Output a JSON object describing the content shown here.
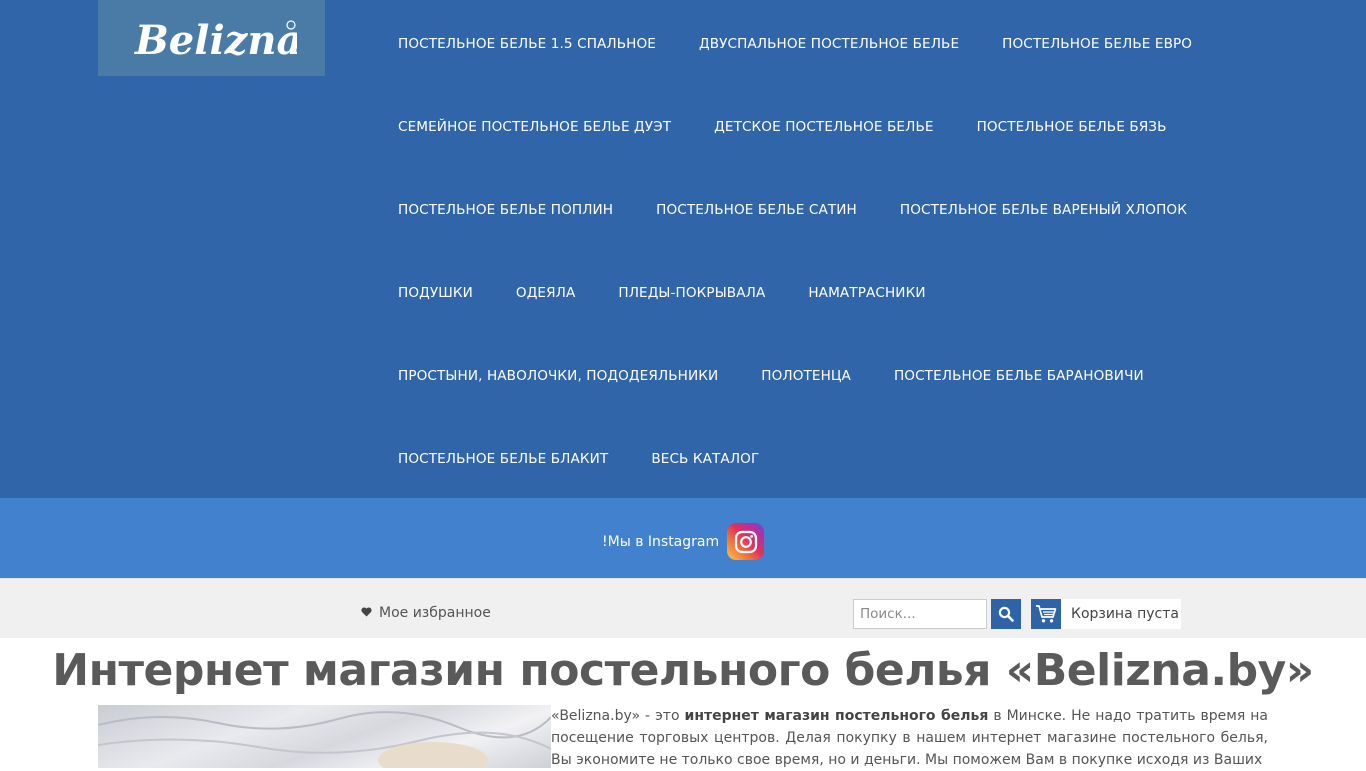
{
  "header": {
    "logo_text": "Belizna",
    "nav_rows": [
      [
        "ПОСТЕЛЬНОЕ БЕЛЬЕ 1.5 СПАЛЬНОЕ",
        "ДВУСПАЛЬНОЕ ПОСТЕЛЬНОЕ БЕЛЬЕ",
        "ПОСТЕЛЬНОЕ БЕЛЬЕ ЕВРО"
      ],
      [
        "СЕМЕЙНОЕ ПОСТЕЛЬНОЕ БЕЛЬЕ ДУЭТ",
        "ДЕТСКОЕ ПОСТЕЛЬНОЕ БЕЛЬЕ",
        "ПОСТЕЛЬНОЕ БЕЛЬЕ БЯЗЬ"
      ],
      [
        "ПОСТЕЛЬНОЕ БЕЛЬЕ ПОПЛИН",
        "ПОСТЕЛЬНОЕ БЕЛЬЕ САТИН",
        "ПОСТЕЛЬНОЕ БЕЛЬЕ ВАРЕНЫЙ ХЛОПОК"
      ],
      [
        "ПОДУШКИ",
        "ОДЕЯЛА",
        "ПЛЕДЫ-ПОКРЫВАЛА",
        "НАМАТРАСНИКИ"
      ],
      [
        "ПРОСТЫНИ, НАВОЛОЧКИ, ПОДОДЕЯЛЬНИКИ",
        "ПОЛОТЕНЦА",
        "ПОСТЕЛЬНОЕ БЕЛЬЕ БАРАНОВИЧИ"
      ],
      [
        "ПОСТЕЛЬНОЕ БЕЛЬЕ БЛАКИТ",
        "ВЕСЬ КАТАЛОГ"
      ]
    ]
  },
  "instagram": {
    "label": "!Мы в Instagram",
    "icon": "instagram-icon"
  },
  "toolbar": {
    "favorites_label": "Мое избранное",
    "favorites_icon": "heart-icon",
    "search_placeholder": "Поиск...",
    "search_icon": "search-icon",
    "cart_label": "Корзина пуста",
    "cart_icon": "cart-icon"
  },
  "main": {
    "title": "Интернет магазин постельного белья «Belizna.by»",
    "intro": {
      "part1": " «Belizna.by» - это ",
      "bold": "интернет магазин постельного белья",
      "part2": " в Минске. Не надо тратить время на посещение торговых центров. Делая покупку в нашем  интернет магазине постельного белья, Вы экономите не только свое время, но и деньги. Мы поможем Вам в покупке исходя из Ваших"
    }
  },
  "colors": {
    "header_bg": "#3165a9",
    "logo_bg": "#4a7ba6",
    "instagram_band_bg": "#4281ce",
    "toolbar_bg": "#f0f0f0",
    "accent": "#2f63a8",
    "title_text": "#5a5a5a"
  }
}
